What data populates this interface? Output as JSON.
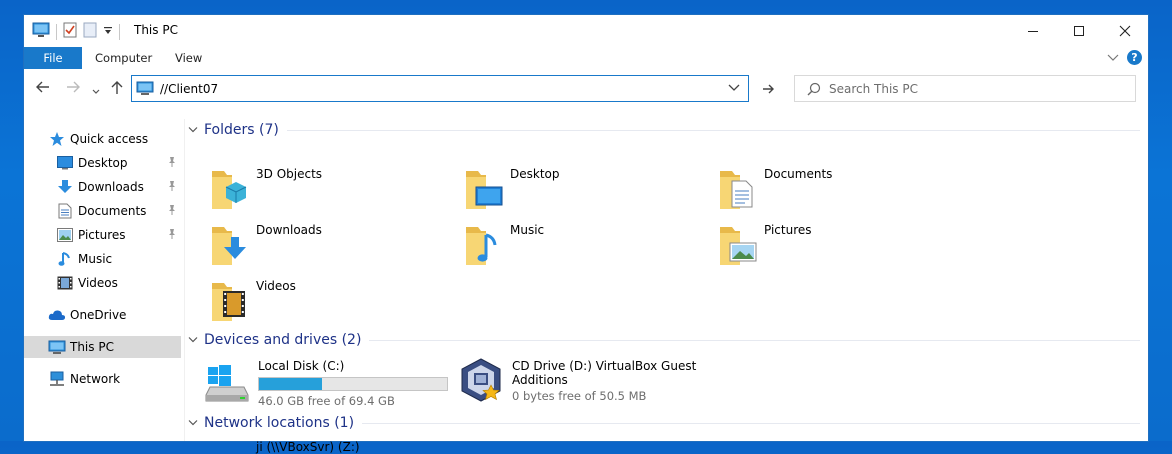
{
  "window": {
    "title": "This PC"
  },
  "ribbon": {
    "tabs": [
      "File",
      "Computer",
      "View"
    ]
  },
  "address": {
    "path": "//Client07"
  },
  "search": {
    "placeholder": "Search This PC"
  },
  "nav": {
    "items": [
      {
        "label": "Quick access",
        "icon": "star-icon"
      },
      {
        "label": "Desktop",
        "icon": "desktop-icon",
        "pinned": true
      },
      {
        "label": "Downloads",
        "icon": "downloads-icon",
        "pinned": true
      },
      {
        "label": "Documents",
        "icon": "documents-icon",
        "pinned": true
      },
      {
        "label": "Pictures",
        "icon": "pictures-icon",
        "pinned": true
      },
      {
        "label": "Music",
        "icon": "music-icon"
      },
      {
        "label": "Videos",
        "icon": "videos-icon"
      },
      {
        "label": "OneDrive",
        "icon": "cloud-icon"
      },
      {
        "label": "This PC",
        "icon": "computer-icon",
        "selected": true
      },
      {
        "label": "Network",
        "icon": "network-icon"
      }
    ]
  },
  "groups": {
    "folders": "Folders (7)",
    "devices": "Devices and drives (2)",
    "network": "Network locations (1)"
  },
  "folders": [
    "3D Objects",
    "Desktop",
    "Documents",
    "Downloads",
    "Music",
    "Pictures",
    "Videos"
  ],
  "drives": [
    {
      "name": "Local Disk (C:)",
      "free": "46.0 GB free of 69.4 GB",
      "used_fraction": 0.337
    },
    {
      "name_line1": "CD Drive (D:) VirtualBox Guest",
      "name_line2": "Additions",
      "free": "0 bytes free of 50.5 MB"
    }
  ],
  "network_locations": [
    "ji (\\\\VBoxSvr) (Z:)"
  ],
  "colors": {
    "accent": "#1979ca",
    "group_title": "#1e3287",
    "bar_fill": "#26a0da"
  }
}
